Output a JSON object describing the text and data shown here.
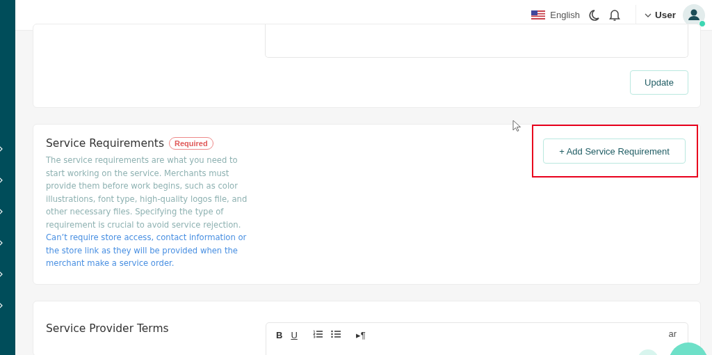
{
  "header": {
    "language": "English",
    "user": "User",
    "user_online": true
  },
  "sidebar": {
    "items": [
      {
        "expanded": false
      },
      {
        "expanded": false
      },
      {
        "expanded": false
      },
      {
        "expanded": false
      },
      {
        "expanded": false
      },
      {
        "expanded": false
      }
    ]
  },
  "details_card": {
    "button": "Update"
  },
  "requirements_card": {
    "title": "Service Requirements",
    "badge": "Required",
    "description": "The service requirements are what you need to start working on the service. Merchants must provide them before work begins, such as color illustrations, font type, high-quality logos file, and other necessary files. Specifying the type of requirement is crucial to avoid service rejection.",
    "note": "Can’t require store access, contact information or the store link as they will be provided when the merchant make a service order.",
    "button": "+ Add Service Requirement",
    "highlighted": true
  },
  "terms_card": {
    "title": "Service Provider Terms",
    "toolbar": [
      {
        "kind": "bold",
        "label": "B"
      },
      {
        "kind": "underline",
        "label": "U"
      },
      {
        "kind": "ordered-list"
      },
      {
        "kind": "bullet-list"
      },
      {
        "kind": "direction",
        "label": "▸¶"
      }
    ],
    "language": "ar"
  }
}
